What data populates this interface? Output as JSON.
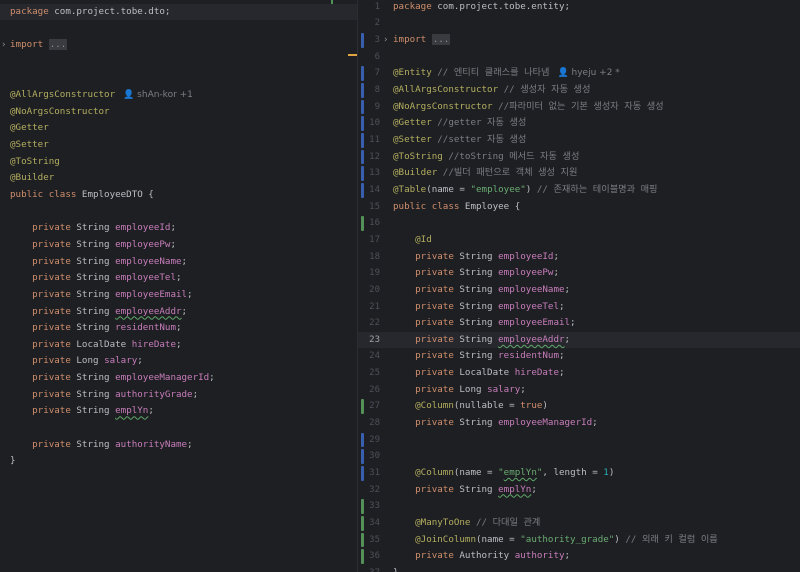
{
  "colors": {
    "background": "#1e1f22",
    "keyword": "#cf8e6d",
    "annotation": "#b3ae60",
    "field": "#c77dbb",
    "string": "#6aab73",
    "comment": "#7a7e85",
    "number": "#2aacb8",
    "marker_modified": "#375fad",
    "marker_added": "#549159"
  },
  "left": {
    "lines": [
      {
        "hl": true,
        "tokens": [
          {
            "c": "kw",
            "t": "package "
          },
          {
            "c": "tx",
            "t": "com.project.tobe.dto;"
          }
        ]
      },
      {
        "tokens": []
      },
      {
        "fold": "›",
        "tokens": [
          {
            "c": "kw",
            "t": "import "
          },
          {
            "c": "fo",
            "t": "..."
          }
        ]
      },
      {
        "tokens": []
      },
      {
        "tokens": []
      },
      {
        "tokens": [
          {
            "c": "an",
            "t": "@AllArgsConstructor"
          }
        ],
        "inlay": "👤 shAn-kor +1"
      },
      {
        "tokens": [
          {
            "c": "an",
            "t": "@NoArgsConstructor"
          }
        ]
      },
      {
        "tokens": [
          {
            "c": "an",
            "t": "@Getter"
          }
        ]
      },
      {
        "tokens": [
          {
            "c": "an",
            "t": "@Setter"
          }
        ]
      },
      {
        "tokens": [
          {
            "c": "an",
            "t": "@ToString"
          }
        ]
      },
      {
        "tokens": [
          {
            "c": "an",
            "t": "@Builder"
          }
        ]
      },
      {
        "tokens": [
          {
            "c": "kw",
            "t": "public class "
          },
          {
            "c": "tx",
            "t": "EmployeeDTO {"
          }
        ]
      },
      {
        "tokens": []
      },
      {
        "tokens": [
          {
            "c": "kw",
            "t": "    private "
          },
          {
            "c": "tx",
            "t": "String "
          },
          {
            "c": "fd",
            "t": "employeeId"
          },
          {
            "c": "tx",
            "t": ";"
          }
        ]
      },
      {
        "tokens": [
          {
            "c": "kw",
            "t": "    private "
          },
          {
            "c": "tx",
            "t": "String "
          },
          {
            "c": "fd",
            "t": "employeePw"
          },
          {
            "c": "tx",
            "t": ";"
          }
        ]
      },
      {
        "tokens": [
          {
            "c": "kw",
            "t": "    private "
          },
          {
            "c": "tx",
            "t": "String "
          },
          {
            "c": "fd",
            "t": "employeeName"
          },
          {
            "c": "tx",
            "t": ";"
          }
        ]
      },
      {
        "tokens": [
          {
            "c": "kw",
            "t": "    private "
          },
          {
            "c": "tx",
            "t": "String "
          },
          {
            "c": "fd",
            "t": "employeeTel"
          },
          {
            "c": "tx",
            "t": ";"
          }
        ]
      },
      {
        "tokens": [
          {
            "c": "kw",
            "t": "    private "
          },
          {
            "c": "tx",
            "t": "String "
          },
          {
            "c": "fd",
            "t": "employeeEmail"
          },
          {
            "c": "tx",
            "t": ";"
          }
        ]
      },
      {
        "tokens": [
          {
            "c": "kw",
            "t": "    private "
          },
          {
            "c": "tx",
            "t": "String "
          },
          {
            "c": "fd wv",
            "t": "employeeAddr"
          },
          {
            "c": "tx",
            "t": ";"
          }
        ]
      },
      {
        "tokens": [
          {
            "c": "kw",
            "t": "    private "
          },
          {
            "c": "tx",
            "t": "String "
          },
          {
            "c": "fd",
            "t": "residentNum"
          },
          {
            "c": "tx",
            "t": ";"
          }
        ]
      },
      {
        "tokens": [
          {
            "c": "kw",
            "t": "    private "
          },
          {
            "c": "tx",
            "t": "LocalDate "
          },
          {
            "c": "fd",
            "t": "hireDate"
          },
          {
            "c": "tx",
            "t": ";"
          }
        ]
      },
      {
        "tokens": [
          {
            "c": "kw",
            "t": "    private "
          },
          {
            "c": "tx",
            "t": "Long "
          },
          {
            "c": "fd",
            "t": "salary"
          },
          {
            "c": "tx",
            "t": ";"
          }
        ]
      },
      {
        "tokens": [
          {
            "c": "kw",
            "t": "    private "
          },
          {
            "c": "tx",
            "t": "String "
          },
          {
            "c": "fd",
            "t": "employeeManagerId"
          },
          {
            "c": "tx",
            "t": ";"
          }
        ]
      },
      {
        "tokens": [
          {
            "c": "kw",
            "t": "    private "
          },
          {
            "c": "tx",
            "t": "String "
          },
          {
            "c": "fd",
            "t": "authorityGrade"
          },
          {
            "c": "tx",
            "t": ";"
          }
        ]
      },
      {
        "tokens": [
          {
            "c": "kw",
            "t": "    private "
          },
          {
            "c": "tx",
            "t": "String "
          },
          {
            "c": "fd wv",
            "t": "emplYn"
          },
          {
            "c": "tx",
            "t": ";"
          }
        ]
      },
      {
        "tokens": []
      },
      {
        "tokens": [
          {
            "c": "kw",
            "t": "    private "
          },
          {
            "c": "tx",
            "t": "String "
          },
          {
            "c": "fd",
            "t": "authorityName"
          },
          {
            "c": "tx",
            "t": ";"
          }
        ]
      },
      {
        "tokens": [
          {
            "c": "tx",
            "t": "}"
          }
        ]
      }
    ]
  },
  "right": {
    "lines": [
      {
        "num": "1",
        "tokens": [
          {
            "c": "kw",
            "t": "package "
          },
          {
            "c": "tx",
            "t": "com.project.tobe.entity;"
          }
        ]
      },
      {
        "num": "2",
        "tokens": []
      },
      {
        "num": "3",
        "mark": "blue",
        "fold": "›",
        "tokens": [
          {
            "c": "kw",
            "t": "import "
          },
          {
            "c": "fo",
            "t": "..."
          }
        ]
      },
      {
        "num": "6",
        "tokens": []
      },
      {
        "num": "7",
        "mark": "blue",
        "tokens": [
          {
            "c": "an",
            "t": "@Entity "
          },
          {
            "c": "cm",
            "t": "// 엔티티 클래스를 나타냄"
          }
        ],
        "inlay": "👤 hyeju +2 *"
      },
      {
        "num": "8",
        "mark": "blue",
        "tokens": [
          {
            "c": "an",
            "t": "@AllArgsConstructor "
          },
          {
            "c": "cm",
            "t": "// 생성자 자동 생성"
          }
        ]
      },
      {
        "num": "9",
        "mark": "blue",
        "tokens": [
          {
            "c": "an",
            "t": "@NoArgsConstructor "
          },
          {
            "c": "cm",
            "t": "//파라미터 없는 기본 생성자 자동 생성"
          }
        ]
      },
      {
        "num": "10",
        "mark": "blue",
        "tokens": [
          {
            "c": "an",
            "t": "@Getter "
          },
          {
            "c": "cm",
            "t": "//getter 자동 생성"
          }
        ]
      },
      {
        "num": "11",
        "mark": "blue",
        "tokens": [
          {
            "c": "an",
            "t": "@Setter "
          },
          {
            "c": "cm",
            "t": "//setter 자동 생성"
          }
        ]
      },
      {
        "num": "12",
        "mark": "blue",
        "tokens": [
          {
            "c": "an",
            "t": "@ToString "
          },
          {
            "c": "cm",
            "t": "//toString 메서드 자동 생성"
          }
        ]
      },
      {
        "num": "13",
        "mark": "blue",
        "tokens": [
          {
            "c": "an",
            "t": "@Builder "
          },
          {
            "c": "cm",
            "t": "//빌더 패턴으로 객체 생성 지원"
          }
        ]
      },
      {
        "num": "14",
        "mark": "blue",
        "tokens": [
          {
            "c": "an",
            "t": "@Table"
          },
          {
            "c": "tx",
            "t": "(name = "
          },
          {
            "c": "st",
            "t": "\"employee\""
          },
          {
            "c": "tx",
            "t": ") "
          },
          {
            "c": "cm",
            "t": "// 존재하는 테이블명과 매핑"
          }
        ]
      },
      {
        "num": "15",
        "tokens": [
          {
            "c": "kw",
            "t": "public class "
          },
          {
            "c": "tx",
            "t": "Employee {"
          }
        ]
      },
      {
        "num": "16",
        "mark": "green",
        "tokens": []
      },
      {
        "num": "17",
        "tokens": [
          {
            "c": "an",
            "t": "    @Id"
          }
        ]
      },
      {
        "num": "18",
        "tokens": [
          {
            "c": "kw",
            "t": "    private "
          },
          {
            "c": "tx",
            "t": "String "
          },
          {
            "c": "fd",
            "t": "employeeId"
          },
          {
            "c": "tx",
            "t": ";"
          }
        ]
      },
      {
        "num": "19",
        "tokens": [
          {
            "c": "kw",
            "t": "    private "
          },
          {
            "c": "tx",
            "t": "String "
          },
          {
            "c": "fd",
            "t": "employeePw"
          },
          {
            "c": "tx",
            "t": ";"
          }
        ]
      },
      {
        "num": "20",
        "tokens": [
          {
            "c": "kw",
            "t": "    private "
          },
          {
            "c": "tx",
            "t": "String "
          },
          {
            "c": "fd",
            "t": "employeeName"
          },
          {
            "c": "tx",
            "t": ";"
          }
        ]
      },
      {
        "num": "21",
        "tokens": [
          {
            "c": "kw",
            "t": "    private "
          },
          {
            "c": "tx",
            "t": "String "
          },
          {
            "c": "fd",
            "t": "employeeTel"
          },
          {
            "c": "tx",
            "t": ";"
          }
        ]
      },
      {
        "num": "22",
        "tokens": [
          {
            "c": "kw",
            "t": "    private "
          },
          {
            "c": "tx",
            "t": "String "
          },
          {
            "c": "fd",
            "t": "employeeEmail"
          },
          {
            "c": "tx",
            "t": ";"
          }
        ]
      },
      {
        "num": "23",
        "hl": true,
        "tokens": [
          {
            "c": "kw",
            "t": "    private "
          },
          {
            "c": "tx",
            "t": "String "
          },
          {
            "c": "fd wv",
            "t": "employeeAddr"
          },
          {
            "c": "tx",
            "t": ";"
          }
        ]
      },
      {
        "num": "24",
        "tokens": [
          {
            "c": "kw",
            "t": "    private "
          },
          {
            "c": "tx",
            "t": "String "
          },
          {
            "c": "fd",
            "t": "residentNum"
          },
          {
            "c": "tx",
            "t": ";"
          }
        ]
      },
      {
        "num": "25",
        "tokens": [
          {
            "c": "kw",
            "t": "    private "
          },
          {
            "c": "tx",
            "t": "LocalDate "
          },
          {
            "c": "fd",
            "t": "hireDate"
          },
          {
            "c": "tx",
            "t": ";"
          }
        ]
      },
      {
        "num": "26",
        "tokens": [
          {
            "c": "kw",
            "t": "    private "
          },
          {
            "c": "tx",
            "t": "Long "
          },
          {
            "c": "fd",
            "t": "salary"
          },
          {
            "c": "tx",
            "t": ";"
          }
        ]
      },
      {
        "num": "27",
        "mark": "green",
        "tokens": [
          {
            "c": "an",
            "t": "    @Column"
          },
          {
            "c": "tx",
            "t": "(nullable = "
          },
          {
            "c": "kw",
            "t": "true"
          },
          {
            "c": "tx",
            "t": ")"
          }
        ]
      },
      {
        "num": "28",
        "tokens": [
          {
            "c": "kw",
            "t": "    private "
          },
          {
            "c": "tx",
            "t": "String "
          },
          {
            "c": "fd",
            "t": "employeeManagerId"
          },
          {
            "c": "tx",
            "t": ";"
          }
        ]
      },
      {
        "num": "29",
        "mark": "blue",
        "tokens": []
      },
      {
        "num": "30",
        "mark": "blue",
        "tokens": []
      },
      {
        "num": "31",
        "mark": "blue",
        "tokens": [
          {
            "c": "an",
            "t": "    @Column"
          },
          {
            "c": "tx",
            "t": "(name = "
          },
          {
            "c": "st",
            "t": "\""
          },
          {
            "c": "st wv",
            "t": "emplYn"
          },
          {
            "c": "st",
            "t": "\""
          },
          {
            "c": "tx",
            "t": ", length = "
          },
          {
            "c": "nu",
            "t": "1"
          },
          {
            "c": "tx",
            "t": ")"
          }
        ]
      },
      {
        "num": "32",
        "tokens": [
          {
            "c": "kw",
            "t": "    private "
          },
          {
            "c": "tx",
            "t": "String "
          },
          {
            "c": "fd wv",
            "t": "emplYn"
          },
          {
            "c": "tx",
            "t": ";"
          }
        ]
      },
      {
        "num": "33",
        "mark": "green",
        "tokens": []
      },
      {
        "num": "34",
        "mark": "green",
        "tokens": [
          {
            "c": "an",
            "t": "    @ManyToOne "
          },
          {
            "c": "cm",
            "t": "// 다대일 관계"
          }
        ]
      },
      {
        "num": "35",
        "mark": "green",
        "tokens": [
          {
            "c": "an",
            "t": "    @JoinColumn"
          },
          {
            "c": "tx",
            "t": "(name = "
          },
          {
            "c": "st",
            "t": "\"authority_grade\""
          },
          {
            "c": "tx",
            "t": ") "
          },
          {
            "c": "cm",
            "t": "// 외래 키 컬럼 이름"
          }
        ]
      },
      {
        "num": "36",
        "mark": "green",
        "tokens": [
          {
            "c": "kw",
            "t": "    private "
          },
          {
            "c": "tx",
            "t": "Authority "
          },
          {
            "c": "fd",
            "t": "authority"
          },
          {
            "c": "tx",
            "t": ";"
          }
        ]
      },
      {
        "num": "37",
        "tokens": [
          {
            "c": "tx",
            "t": "}"
          }
        ]
      }
    ]
  }
}
